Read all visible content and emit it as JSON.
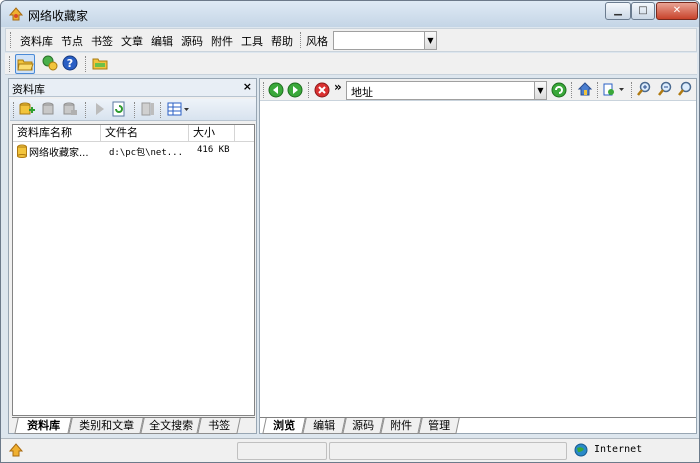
{
  "window": {
    "title": "网络收藏家",
    "min_label": "▁",
    "max_label": "□",
    "close_label": "✕"
  },
  "menu": {
    "items": [
      "资料库",
      "节点",
      "书签",
      "文章",
      "编辑",
      "源码",
      "附件",
      "工具",
      "帮助"
    ],
    "style_label": "风格",
    "style_value": ""
  },
  "left_panel": {
    "title": "资料库",
    "close_glyph": "×",
    "columns": [
      "资料库名称",
      "文件名",
      "大小"
    ],
    "rows": [
      {
        "name": "网络收藏家...",
        "file": "d:\\pc包\\net...",
        "size": "416 KB"
      }
    ],
    "tabs": [
      "资料库",
      "类别和文章",
      "全文搜索",
      "书签"
    ],
    "selected_tab": "资料库"
  },
  "browser": {
    "more_glyph": "»",
    "address_label": "地址",
    "address_value": "",
    "tabs": [
      "浏览",
      "编辑",
      "源码",
      "附件",
      "管理"
    ],
    "selected_tab": "浏览"
  },
  "status": {
    "zone_text": "Internet"
  },
  "colors": {
    "nav_green": "#3aa83a",
    "stop_red": "#d93030",
    "help_blue": "#2a5fc4",
    "folder_yellow": "#f2c43c"
  }
}
